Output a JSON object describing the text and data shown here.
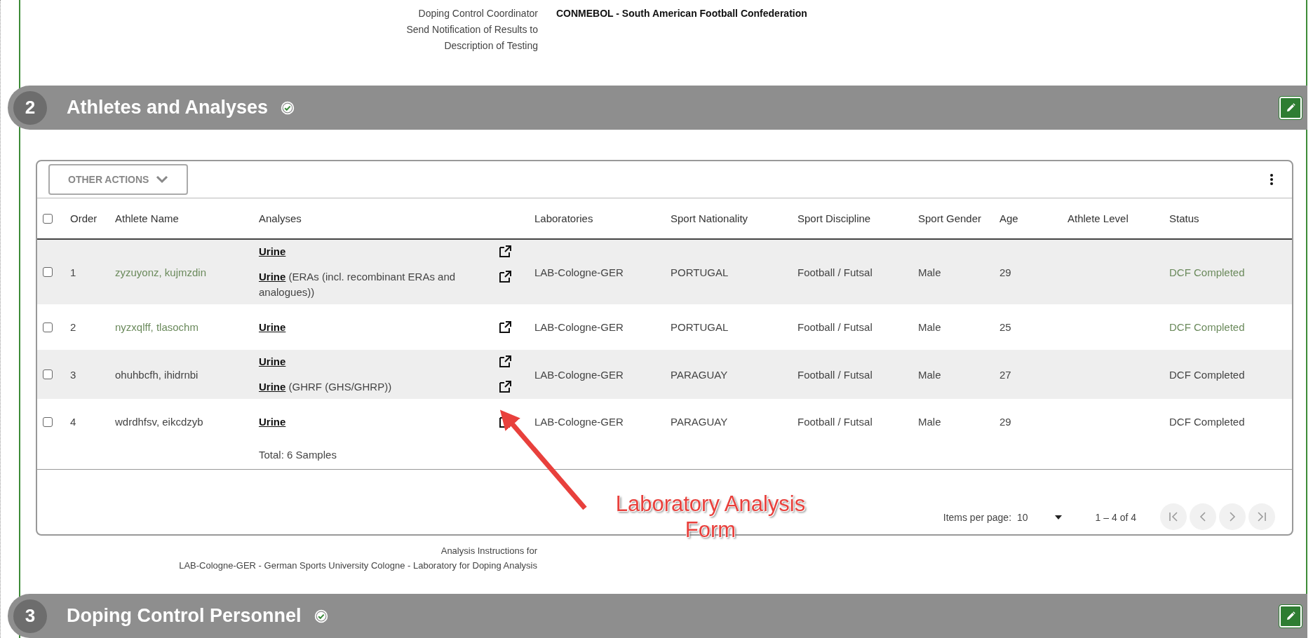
{
  "info_rows": [
    {
      "label": "Doping Control Coordinator",
      "value": "CONMEBOL - South American Football Confederation"
    },
    {
      "label": "Send Notification of Results to"
    },
    {
      "label": "Description of Testing"
    }
  ],
  "section": {
    "number": "2",
    "title": "Athletes and Analyses",
    "completed": true
  },
  "toolbar": {
    "actions_button": "OTHER ACTIONS"
  },
  "table": {
    "select_all": {
      "checked": false
    },
    "columns": [
      "Order",
      "Athlete Name",
      "Analyses",
      "Laboratories",
      "Sport Nationality",
      "Sport Discipline",
      "Sport Gender",
      "Age",
      "Athlete Level",
      "Status"
    ],
    "rows": [
      {
        "checked": false,
        "order": "1",
        "athlete": "zyzuyonz, kujmzdin",
        "color": "#6b8a5c",
        "analyses": [
          {
            "sample": "Urine"
          },
          {
            "sample": "Urine",
            "detail": "(ERAs (incl. recombinant ERAs and analogues))"
          }
        ],
        "laboratory": "LAB-Cologne-GER",
        "nationality": "PORTUGAL",
        "discipline": "Football / Futsal",
        "gender": "Male",
        "age": "29",
        "status": "DCF Completed"
      },
      {
        "checked": false,
        "order": "2",
        "athlete": "nyzxqlff, tlasochm",
        "color": "#6b8a5c",
        "analyses": [
          {
            "sample": "Urine"
          }
        ],
        "laboratory": "LAB-Cologne-GER",
        "nationality": "PORTUGAL",
        "discipline": "Football / Futsal",
        "gender": "Male",
        "age": "25",
        "status": "DCF Completed"
      },
      {
        "checked": false,
        "order": "3",
        "athlete": "ohuhbcfh, ihidrnbi",
        "color": "#444444",
        "analyses": [
          {
            "sample": "Urine"
          },
          {
            "sample": "Urine",
            "detail": "(GHRF (GHS/GHRP))"
          }
        ],
        "laboratory": "LAB-Cologne-GER",
        "nationality": "PARAGUAY",
        "discipline": "Football / Futsal",
        "gender": "Male",
        "age": "27",
        "status": "DCF Completed"
      },
      {
        "checked": false,
        "order": "4",
        "athlete": "wdrdhfsv, eikcdzyb",
        "color": "#444444",
        "analyses": [
          {
            "sample": "Urine"
          }
        ],
        "laboratory": "LAB-Cologne-GER",
        "nationality": "PARAGUAY",
        "discipline": "Football / Futsal",
        "gender": "Male",
        "age": "29",
        "status": "DCF Completed"
      }
    ],
    "total": "Total: 6 Samples"
  },
  "paginator": {
    "items_per_page_label": "Items per page:",
    "items_per_page": "10",
    "range": "1 – 4 of 4",
    "buttons": [
      {
        "kind": "first",
        "disabled": true
      },
      {
        "kind": "previous",
        "disabled": true
      },
      {
        "kind": "next",
        "disabled": true
      },
      {
        "kind": "last",
        "disabled": true
      }
    ]
  },
  "annotation": {
    "text": "Laboratory Analysis Form"
  },
  "instructions": [
    "Analysis Instructions for",
    "LAB-Cologne-GER - German Sports University Cologne - Laboratory for Doping Analysis"
  ],
  "next_section": {
    "number": "3",
    "title": "Doping Control Personnel",
    "completed": true
  }
}
